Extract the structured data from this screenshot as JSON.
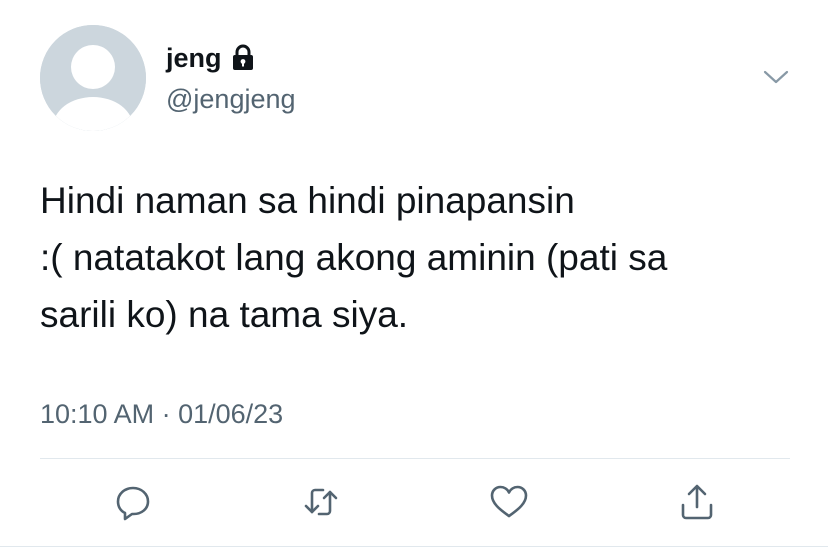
{
  "author": {
    "name": "jeng",
    "handle": "@jengjeng",
    "protected_icon": "lock-icon",
    "avatar_icon": "default-avatar"
  },
  "menu_icon": "chevron-down-icon",
  "tweet": {
    "text": "Hindi naman sa hindi pinapansin\n:( natatakot lang akong aminin (pati sa\nsarili ko) na tama siya.",
    "timestamp": "10:10 AM · 01/06/23"
  },
  "actions": [
    {
      "name": "reply",
      "icon": "reply-icon"
    },
    {
      "name": "retweet",
      "icon": "retweet-icon"
    },
    {
      "name": "like",
      "icon": "heart-icon"
    },
    {
      "name": "share",
      "icon": "share-icon"
    }
  ],
  "colors": {
    "primary_text": "#0f1419",
    "secondary_text": "#536471",
    "icon": "#536471",
    "avatar_bg": "#ccd6dd",
    "divider": "#e1e8ed"
  }
}
